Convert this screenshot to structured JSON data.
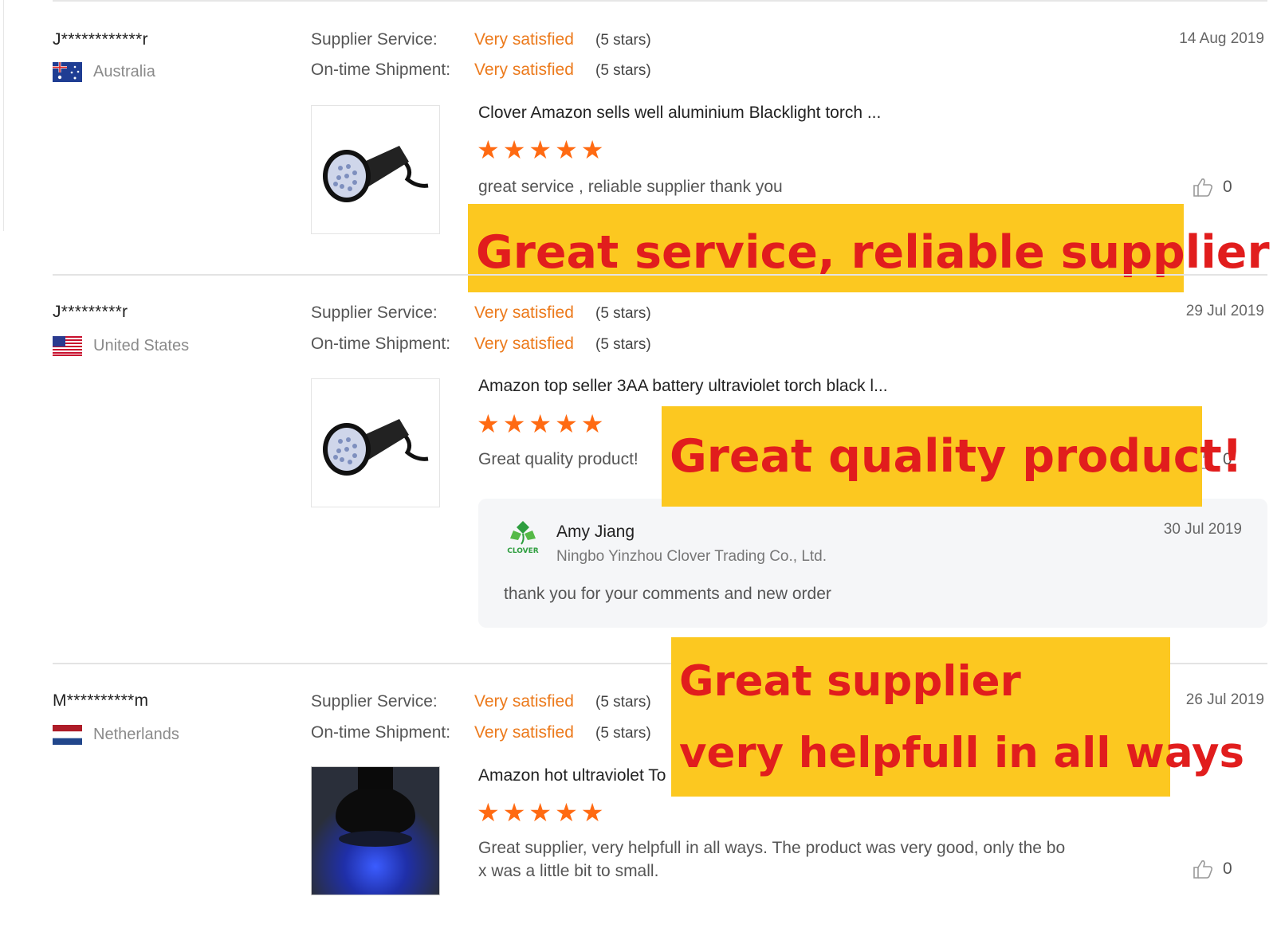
{
  "reviews": [
    {
      "buyer": "J************r",
      "country": "Australia",
      "supplier_service_label": "Supplier Service:",
      "supplier_service_value": "Very satisfied",
      "supplier_service_stars": "(5 stars)",
      "shipment_label": "On-time Shipment:",
      "shipment_value": "Very satisfied",
      "shipment_stars": "(5 stars)",
      "date": "14 Aug 2019",
      "product_title": "Clover Amazon sells well aluminium Blacklight torch ...",
      "rating": 5,
      "comment": "great service , reliable supplier thank you",
      "likes": "0",
      "highlight": "Great service, reliable supplier !"
    },
    {
      "buyer": "J*********r",
      "country": "United States",
      "supplier_service_label": "Supplier Service:",
      "supplier_service_value": "Very satisfied",
      "supplier_service_stars": "(5 stars)",
      "shipment_label": "On-time Shipment:",
      "shipment_value": "Very satisfied",
      "shipment_stars": "(5 stars)",
      "date": "29 Jul 2019",
      "product_title": "Amazon top seller 3AA battery ultraviolet torch black l...",
      "rating": 5,
      "comment": "Great quality product!",
      "likes": "0",
      "highlight": "Great quality product!",
      "reply": {
        "name": "Amy Jiang",
        "company": "Ningbo Yinzhou Clover Trading Co., Ltd.",
        "date": "30 Jul 2019",
        "text": "thank you for your comments and new order",
        "logo_text": "CLOVER"
      }
    },
    {
      "buyer": "M**********m",
      "country": "Netherlands",
      "supplier_service_label": "Supplier Service:",
      "supplier_service_value": "Very satisfied",
      "supplier_service_stars": "(5 stars)",
      "shipment_label": "On-time Shipment:",
      "shipment_value": "Very satisfied",
      "shipment_stars": "(5 stars)",
      "date": "26 Jul 2019",
      "product_title": "Amazon hot ultraviolet To",
      "rating": 5,
      "comment_line1": "Great supplier, very helpfull in all ways. The product was very good, only the bo",
      "comment_line2": "x was a little bit to small.",
      "likes": "0",
      "highlight_line1": "Great supplier",
      "highlight_line2": "very helpfull in all ways"
    }
  ],
  "colors": {
    "accent": "#ec7a1c",
    "star": "#ff6a12",
    "highlight_bg": "#fcc820",
    "highlight_text": "#e11d1d"
  },
  "icons": [
    "thumbs-up-icon",
    "star-icon",
    "flag-australia-icon",
    "flag-us-icon",
    "flag-netherlands-icon",
    "clover-logo-icon",
    "flashlight-image"
  ]
}
